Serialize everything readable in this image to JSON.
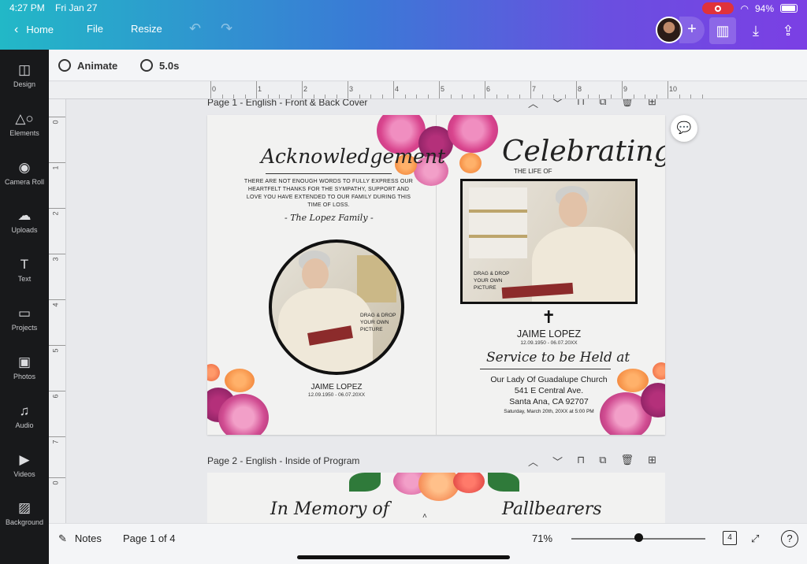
{
  "status": {
    "time": "4:27 PM",
    "date": "Fri Jan 27",
    "battery": "94%"
  },
  "topbar": {
    "home": "Home",
    "file": "File",
    "resize": "Resize"
  },
  "sidebar": {
    "items": [
      {
        "label": "Design",
        "icon": "design-icon"
      },
      {
        "label": "Elements",
        "icon": "elements-icon"
      },
      {
        "label": "Camera Roll",
        "icon": "camera-icon"
      },
      {
        "label": "Uploads",
        "icon": "upload-icon"
      },
      {
        "label": "Text",
        "icon": "text-icon"
      },
      {
        "label": "Projects",
        "icon": "folder-icon"
      },
      {
        "label": "Photos",
        "icon": "photos-icon"
      },
      {
        "label": "Audio",
        "icon": "audio-icon"
      },
      {
        "label": "Videos",
        "icon": "videos-icon"
      },
      {
        "label": "Background",
        "icon": "background-icon"
      }
    ]
  },
  "toolbar": {
    "animate": "Animate",
    "duration": "5.0s"
  },
  "ruler": {
    "top": [
      "0",
      "1",
      "2",
      "3",
      "4",
      "5",
      "6",
      "7",
      "8",
      "9",
      "10"
    ],
    "left": [
      "0",
      "1",
      "2",
      "3",
      "4",
      "5",
      "6",
      "7",
      "0"
    ]
  },
  "page1": {
    "header": "Page 1 - English - Front & Back Cover",
    "left": {
      "title": "Acknowledgement",
      "message": "THERE ARE NOT ENOUGH WORDS TO FULLY EXPRESS OUR HEARTFELT THANKS FOR THE SYMPATHY, SUPPORT AND LOVE YOU HAVE EXTENDED TO OUR FAMILY DURING THIS TIME OF LOSS.",
      "family": "- The Lopez Family -",
      "drop": "DRAG & DROP YOUR OWN PICTURE",
      "name": "JAIME LOPEZ",
      "dates": "12.09.1950 - 06.07.20XX"
    },
    "right": {
      "title": "Celebrating",
      "subtitle": "THE LIFE OF",
      "drop": "DRAG & DROP YOUR OWN PICTURE",
      "cross": "✝",
      "name": "JAIME LOPEZ",
      "dates": "12.09.1950 - 06.07.20XX",
      "service": "Service to be Held at",
      "church": "Our Lady Of Guadalupe Church",
      "address1": "541 E Central Ave.",
      "address2": "Santa Ana, CA 92707",
      "time": "Saturday,  March 20th, 20XX at 5:00 PM"
    }
  },
  "page2": {
    "header": "Page 2 - English - Inside of Program",
    "left_title": "In Memory of",
    "right_title": "Pallbearers"
  },
  "bottombar": {
    "notes": "Notes",
    "page": "Page 1 of 4",
    "zoom": "71%",
    "page_count": "4",
    "help": "?"
  },
  "colors": {
    "brand_gradient_start": "#22b8c7",
    "brand_gradient_end": "#7b3fe4",
    "sidebar": "#18191b",
    "rose": "#d9458e",
    "orange": "#f08a3a"
  }
}
